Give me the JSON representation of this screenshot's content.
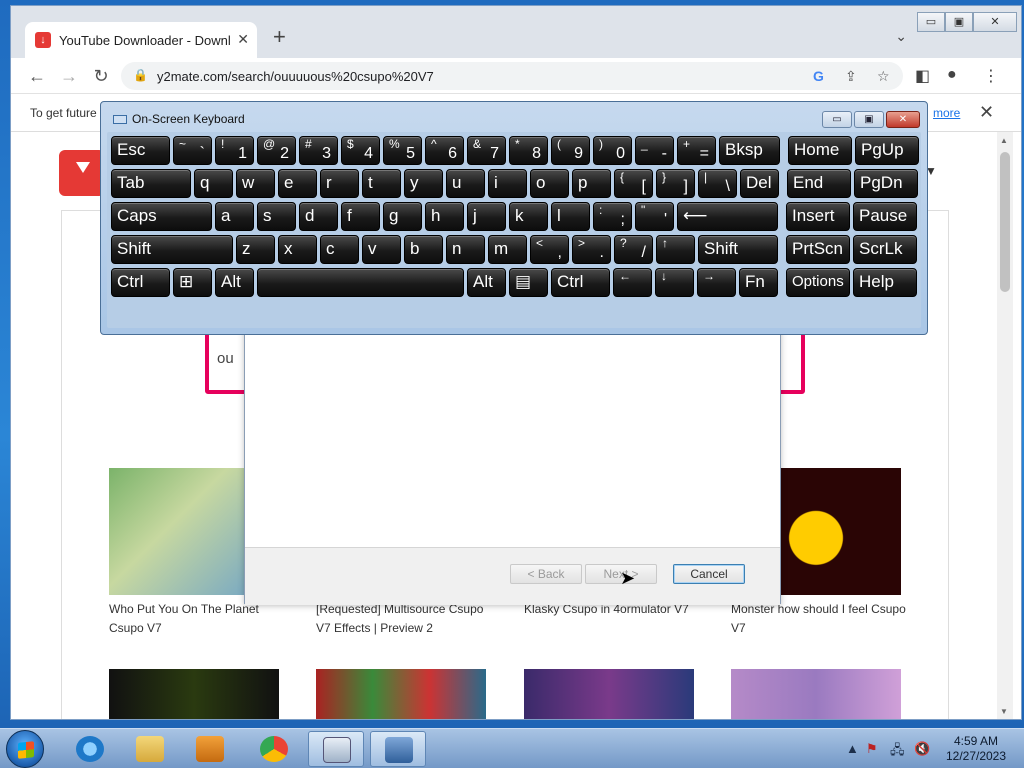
{
  "browser": {
    "tab_title": "YouTube Downloader - Download Video YouTube",
    "tab_close": "✕",
    "new_tab": "+",
    "url": "y2mate.com/search/ouuuuous%20csupo%20V7",
    "infobar_text": "To get future",
    "infobar_link": "more",
    "infobar_close": "✕",
    "window_controls": [
      "▭",
      "▣",
      "✕"
    ],
    "search_value": "ou",
    "videos": [
      {
        "title": "Who Put You On The Planet Csupo V7",
        "color": "#8fb86a"
      },
      {
        "title": "[Requested] Multisource Csupo V7 Effects | Preview 2",
        "color": "#6a6a6a"
      },
      {
        "title": "Klasky Csupo in 4ormulator V7",
        "color": "#555577"
      },
      {
        "title": "Monster how should I feel Csupo V7",
        "color": "#3a0808"
      }
    ]
  },
  "dialog": {
    "back_label": "< Back",
    "next_label": "Next >",
    "cancel_label": "Cancel"
  },
  "osk": {
    "title": "On-Screen Keyboard",
    "controls": [
      "▭",
      "▣",
      "✕"
    ],
    "rows": [
      [
        {
          "main": "Esc",
          "w": 59
        },
        {
          "shift": "~",
          "base": "`",
          "w": 39
        },
        {
          "shift": "!",
          "base": "1",
          "w": 39
        },
        {
          "shift": "@",
          "base": "2",
          "w": 39
        },
        {
          "shift": "#",
          "base": "3",
          "w": 39
        },
        {
          "shift": "$",
          "base": "4",
          "w": 39
        },
        {
          "shift": "%",
          "base": "5",
          "w": 39
        },
        {
          "shift": "^",
          "base": "6",
          "w": 39
        },
        {
          "shift": "&",
          "base": "7",
          "w": 39
        },
        {
          "shift": "*",
          "base": "8",
          "w": 39
        },
        {
          "shift": "(",
          "base": "9",
          "w": 39
        },
        {
          "shift": ")",
          "base": "0",
          "w": 39
        },
        {
          "shift": "_",
          "base": "-",
          "w": 39
        },
        {
          "shift": "+",
          "base": "=",
          "w": 39
        },
        {
          "main": "Bksp",
          "w": 61
        },
        {
          "main": "Home",
          "w": 64,
          "gap": 5
        },
        {
          "main": "PgUp",
          "w": 64
        }
      ],
      [
        {
          "main": "Tab",
          "w": 80
        },
        {
          "main": "q",
          "w": 39
        },
        {
          "main": "w",
          "w": 39
        },
        {
          "main": "e",
          "w": 39
        },
        {
          "main": "r",
          "w": 39
        },
        {
          "main": "t",
          "w": 39
        },
        {
          "main": "y",
          "w": 39
        },
        {
          "main": "u",
          "w": 39
        },
        {
          "main": "i",
          "w": 39
        },
        {
          "main": "o",
          "w": 39
        },
        {
          "main": "p",
          "w": 39
        },
        {
          "shift": "{",
          "base": "[",
          "w": 39
        },
        {
          "shift": "}",
          "base": "]",
          "w": 39
        },
        {
          "shift": "|",
          "base": "\\",
          "w": 39
        },
        {
          "main": "Del",
          "w": 39
        },
        {
          "main": "End",
          "w": 64,
          "gap": 5
        },
        {
          "main": "PgDn",
          "w": 64
        }
      ],
      [
        {
          "main": "Caps",
          "w": 101
        },
        {
          "main": "a",
          "w": 39
        },
        {
          "main": "s",
          "w": 39
        },
        {
          "main": "d",
          "w": 39
        },
        {
          "main": "f",
          "w": 39
        },
        {
          "main": "g",
          "w": 39
        },
        {
          "main": "h",
          "w": 39
        },
        {
          "main": "j",
          "w": 39
        },
        {
          "main": "k",
          "w": 39
        },
        {
          "main": "l",
          "w": 39
        },
        {
          "shift": ":",
          "base": ";",
          "w": 39
        },
        {
          "shift": "\"",
          "base": "'",
          "w": 39
        },
        {
          "main": "⟵",
          "w": 101
        },
        {
          "main": "Insert",
          "w": 64,
          "gap": 5
        },
        {
          "main": "Pause",
          "w": 64
        }
      ],
      [
        {
          "main": "Shift",
          "w": 122
        },
        {
          "main": "z",
          "w": 39
        },
        {
          "main": "x",
          "w": 39
        },
        {
          "main": "c",
          "w": 39
        },
        {
          "main": "v",
          "w": 39
        },
        {
          "main": "b",
          "w": 39
        },
        {
          "main": "n",
          "w": 39
        },
        {
          "main": "m",
          "w": 39
        },
        {
          "shift": "<",
          "base": ",",
          "w": 39
        },
        {
          "shift": ">",
          "base": ".",
          "w": 39
        },
        {
          "shift": "?",
          "base": "/",
          "w": 39
        },
        {
          "shift": "↑",
          "base": "",
          "w": 39
        },
        {
          "main": "Shift",
          "w": 80
        },
        {
          "main": "PrtScn",
          "w": 64,
          "gap": 5
        },
        {
          "main": "ScrLk",
          "w": 64
        }
      ],
      [
        {
          "main": "Ctrl",
          "w": 59
        },
        {
          "main": "⊞",
          "w": 39
        },
        {
          "main": "Alt",
          "w": 39
        },
        {
          "main": "",
          "w": 207
        },
        {
          "main": "Alt",
          "w": 39
        },
        {
          "main": "▤",
          "w": 39
        },
        {
          "main": "Ctrl",
          "w": 59
        },
        {
          "shift": "←",
          "base": "",
          "w": 39
        },
        {
          "shift": "↓",
          "base": "",
          "w": 39
        },
        {
          "shift": "→",
          "base": "",
          "w": 39
        },
        {
          "main": "Fn",
          "w": 39
        },
        {
          "main": "Options",
          "w": 64,
          "gap": 5,
          "small": true
        },
        {
          "main": "Help",
          "w": 64
        }
      ]
    ]
  },
  "taskbar": {
    "time": "4:59 AM",
    "date": "12/27/2023"
  }
}
